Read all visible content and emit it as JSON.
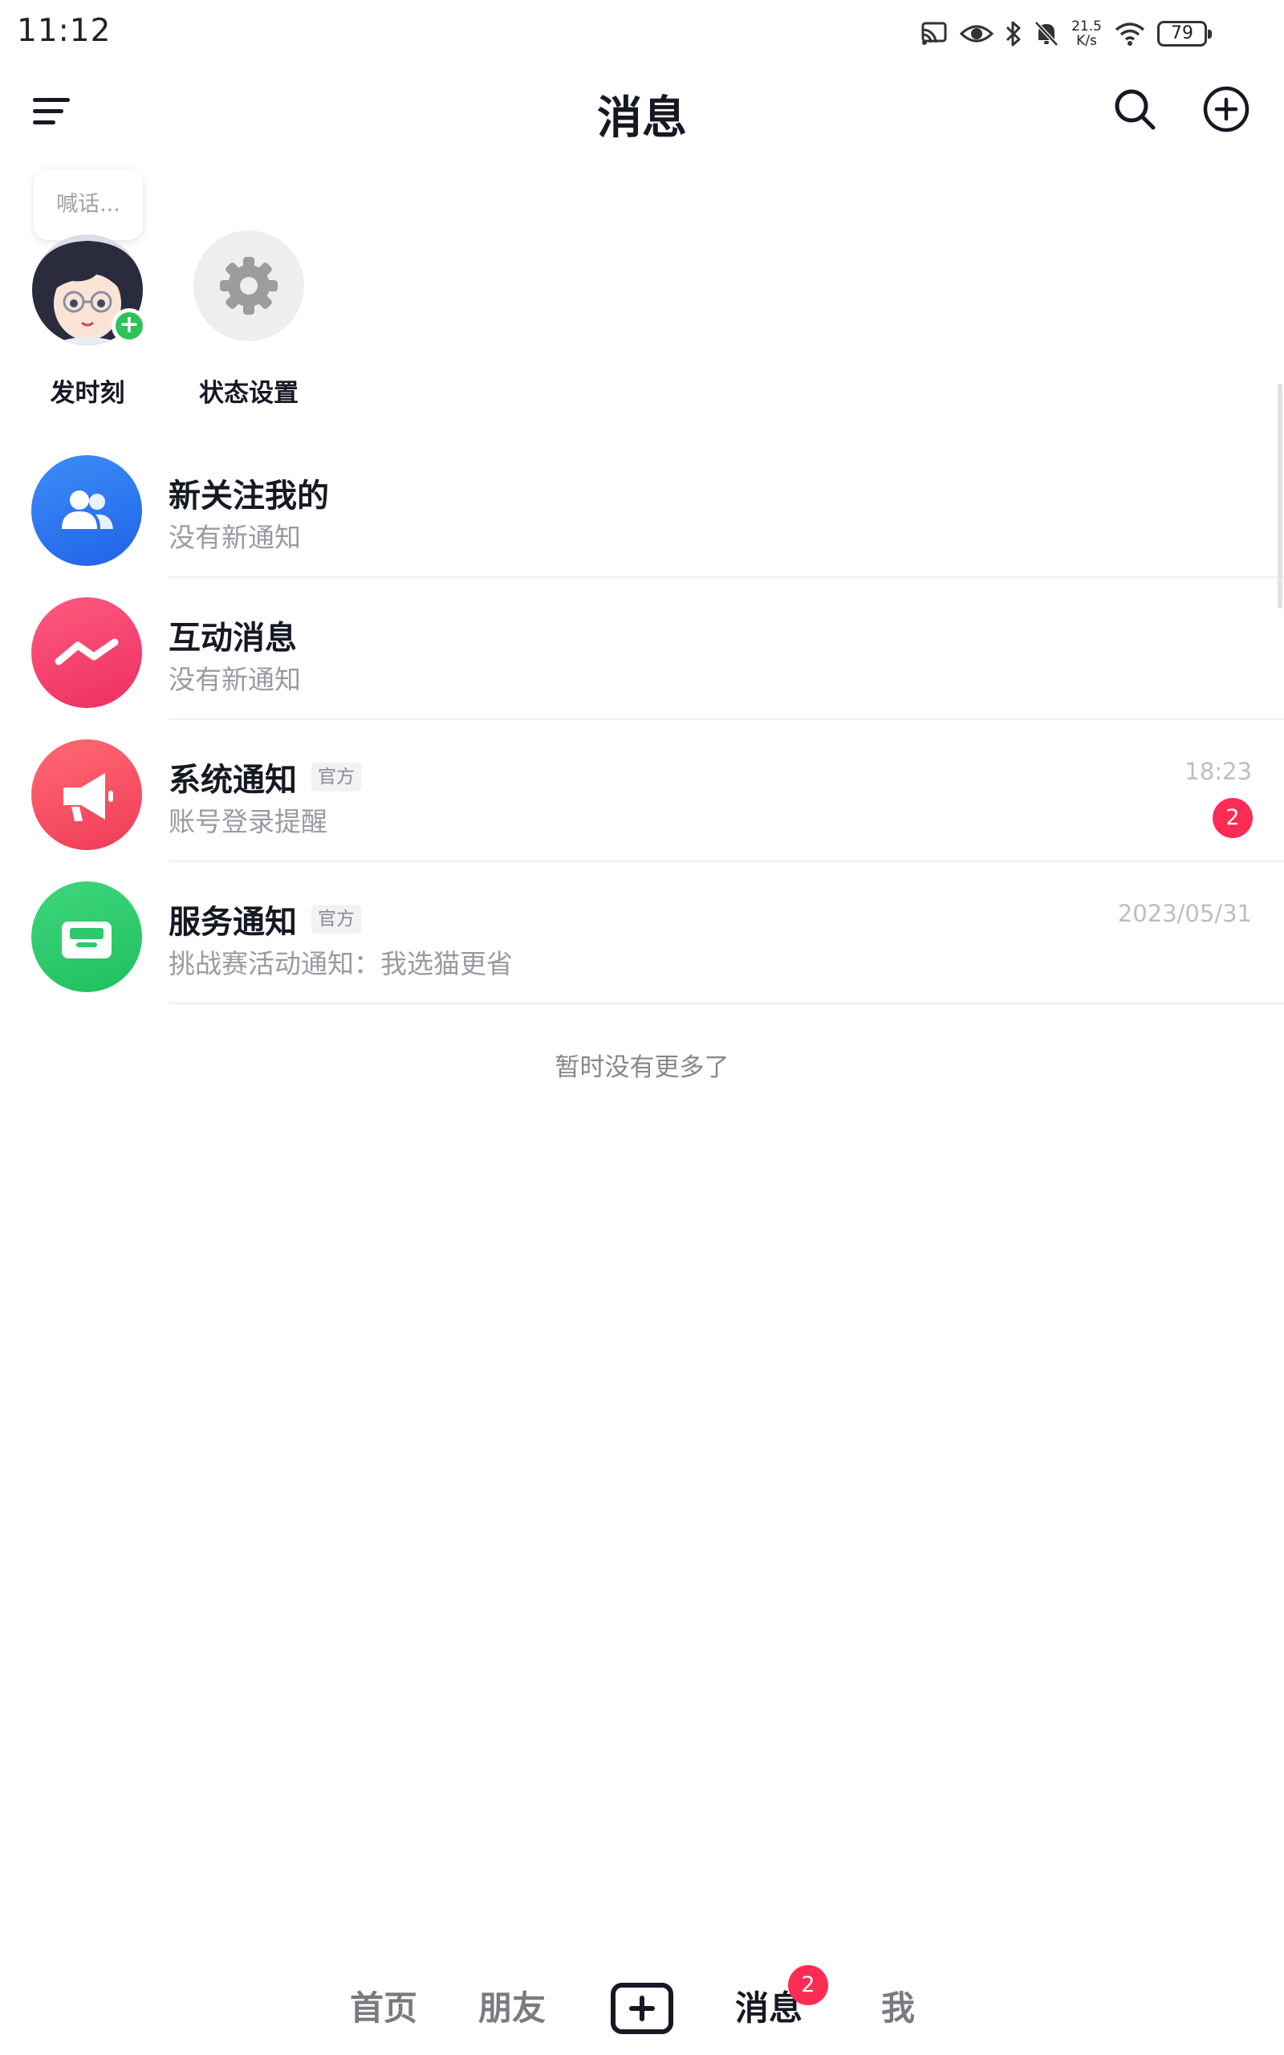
{
  "status_bar": {
    "time": "11:12",
    "net_speed_value": "21.5",
    "net_speed_unit": "K/s",
    "battery": "79",
    "icons": [
      "cast-icon",
      "eye-icon",
      "bluetooth-icon",
      "mute-bell-icon",
      "wifi-icon",
      "battery-icon"
    ]
  },
  "header": {
    "title": "消息",
    "icons": [
      "menu-icon",
      "search-icon",
      "add-circle-icon"
    ]
  },
  "moments": {
    "bubble_text": "喊话...",
    "post_label": "发时刻",
    "settings_label": "状态设置",
    "plus_symbol": "+"
  },
  "messages": [
    {
      "title": "新关注我的",
      "subtitle": "没有新通知",
      "icon": "users-icon",
      "color": "#2f7cf6"
    },
    {
      "title": "互动消息",
      "subtitle": "没有新通知",
      "icon": "wave-icon",
      "color": "#fa3c6b"
    },
    {
      "title": "系统通知",
      "tag": "官方",
      "subtitle": "账号登录提醒",
      "time": "18:23",
      "badge": "2",
      "icon": "megaphone-icon",
      "color": "#f84b5c"
    },
    {
      "title": "服务通知",
      "tag": "官方",
      "subtitle": "挑战赛活动通知：我选猫更省",
      "time": "2023/05/31",
      "icon": "inbox-icon",
      "color": "#2ec96b"
    }
  ],
  "footer_text": "暂时没有更多了",
  "bottom_nav": {
    "items": [
      "首页",
      "朋友",
      "消息",
      "我"
    ],
    "active": "消息",
    "message_badge": "2",
    "create_icon": "plus-square-icon"
  },
  "colors": {
    "accent_red": "#fe2c55",
    "online_green": "#2ec25a",
    "text_primary": "#161823",
    "text_secondary": "#9a9ba1"
  }
}
